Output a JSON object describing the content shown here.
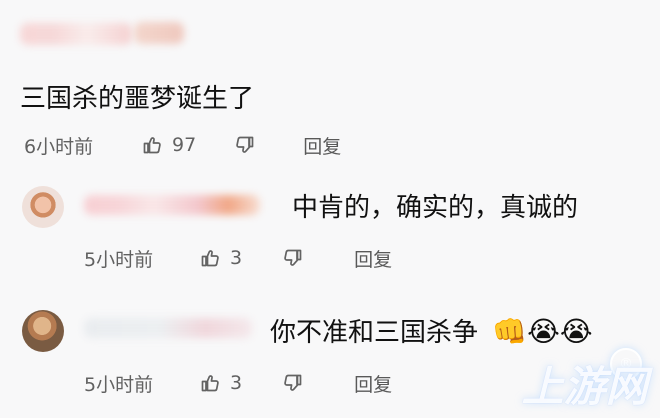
{
  "comments": [
    {
      "text": "三国杀的噩梦诞生了",
      "time": "6小时前",
      "likes": "97",
      "reply_label": "回复"
    },
    {
      "text": "中肯的，确实的，真诚的",
      "time": "5小时前",
      "likes": "3",
      "reply_label": "回复"
    },
    {
      "text": "你不准和三国杀争",
      "emoji": "👊😭😭",
      "time": "5小时前",
      "likes": "3",
      "reply_label": "回复"
    }
  ],
  "watermark": {
    "text": "上游网"
  },
  "icons": {
    "like": "thumbs-up-icon",
    "dislike": "thumbs-down-icon",
    "watermark_logo": "registered-mark-icon"
  }
}
